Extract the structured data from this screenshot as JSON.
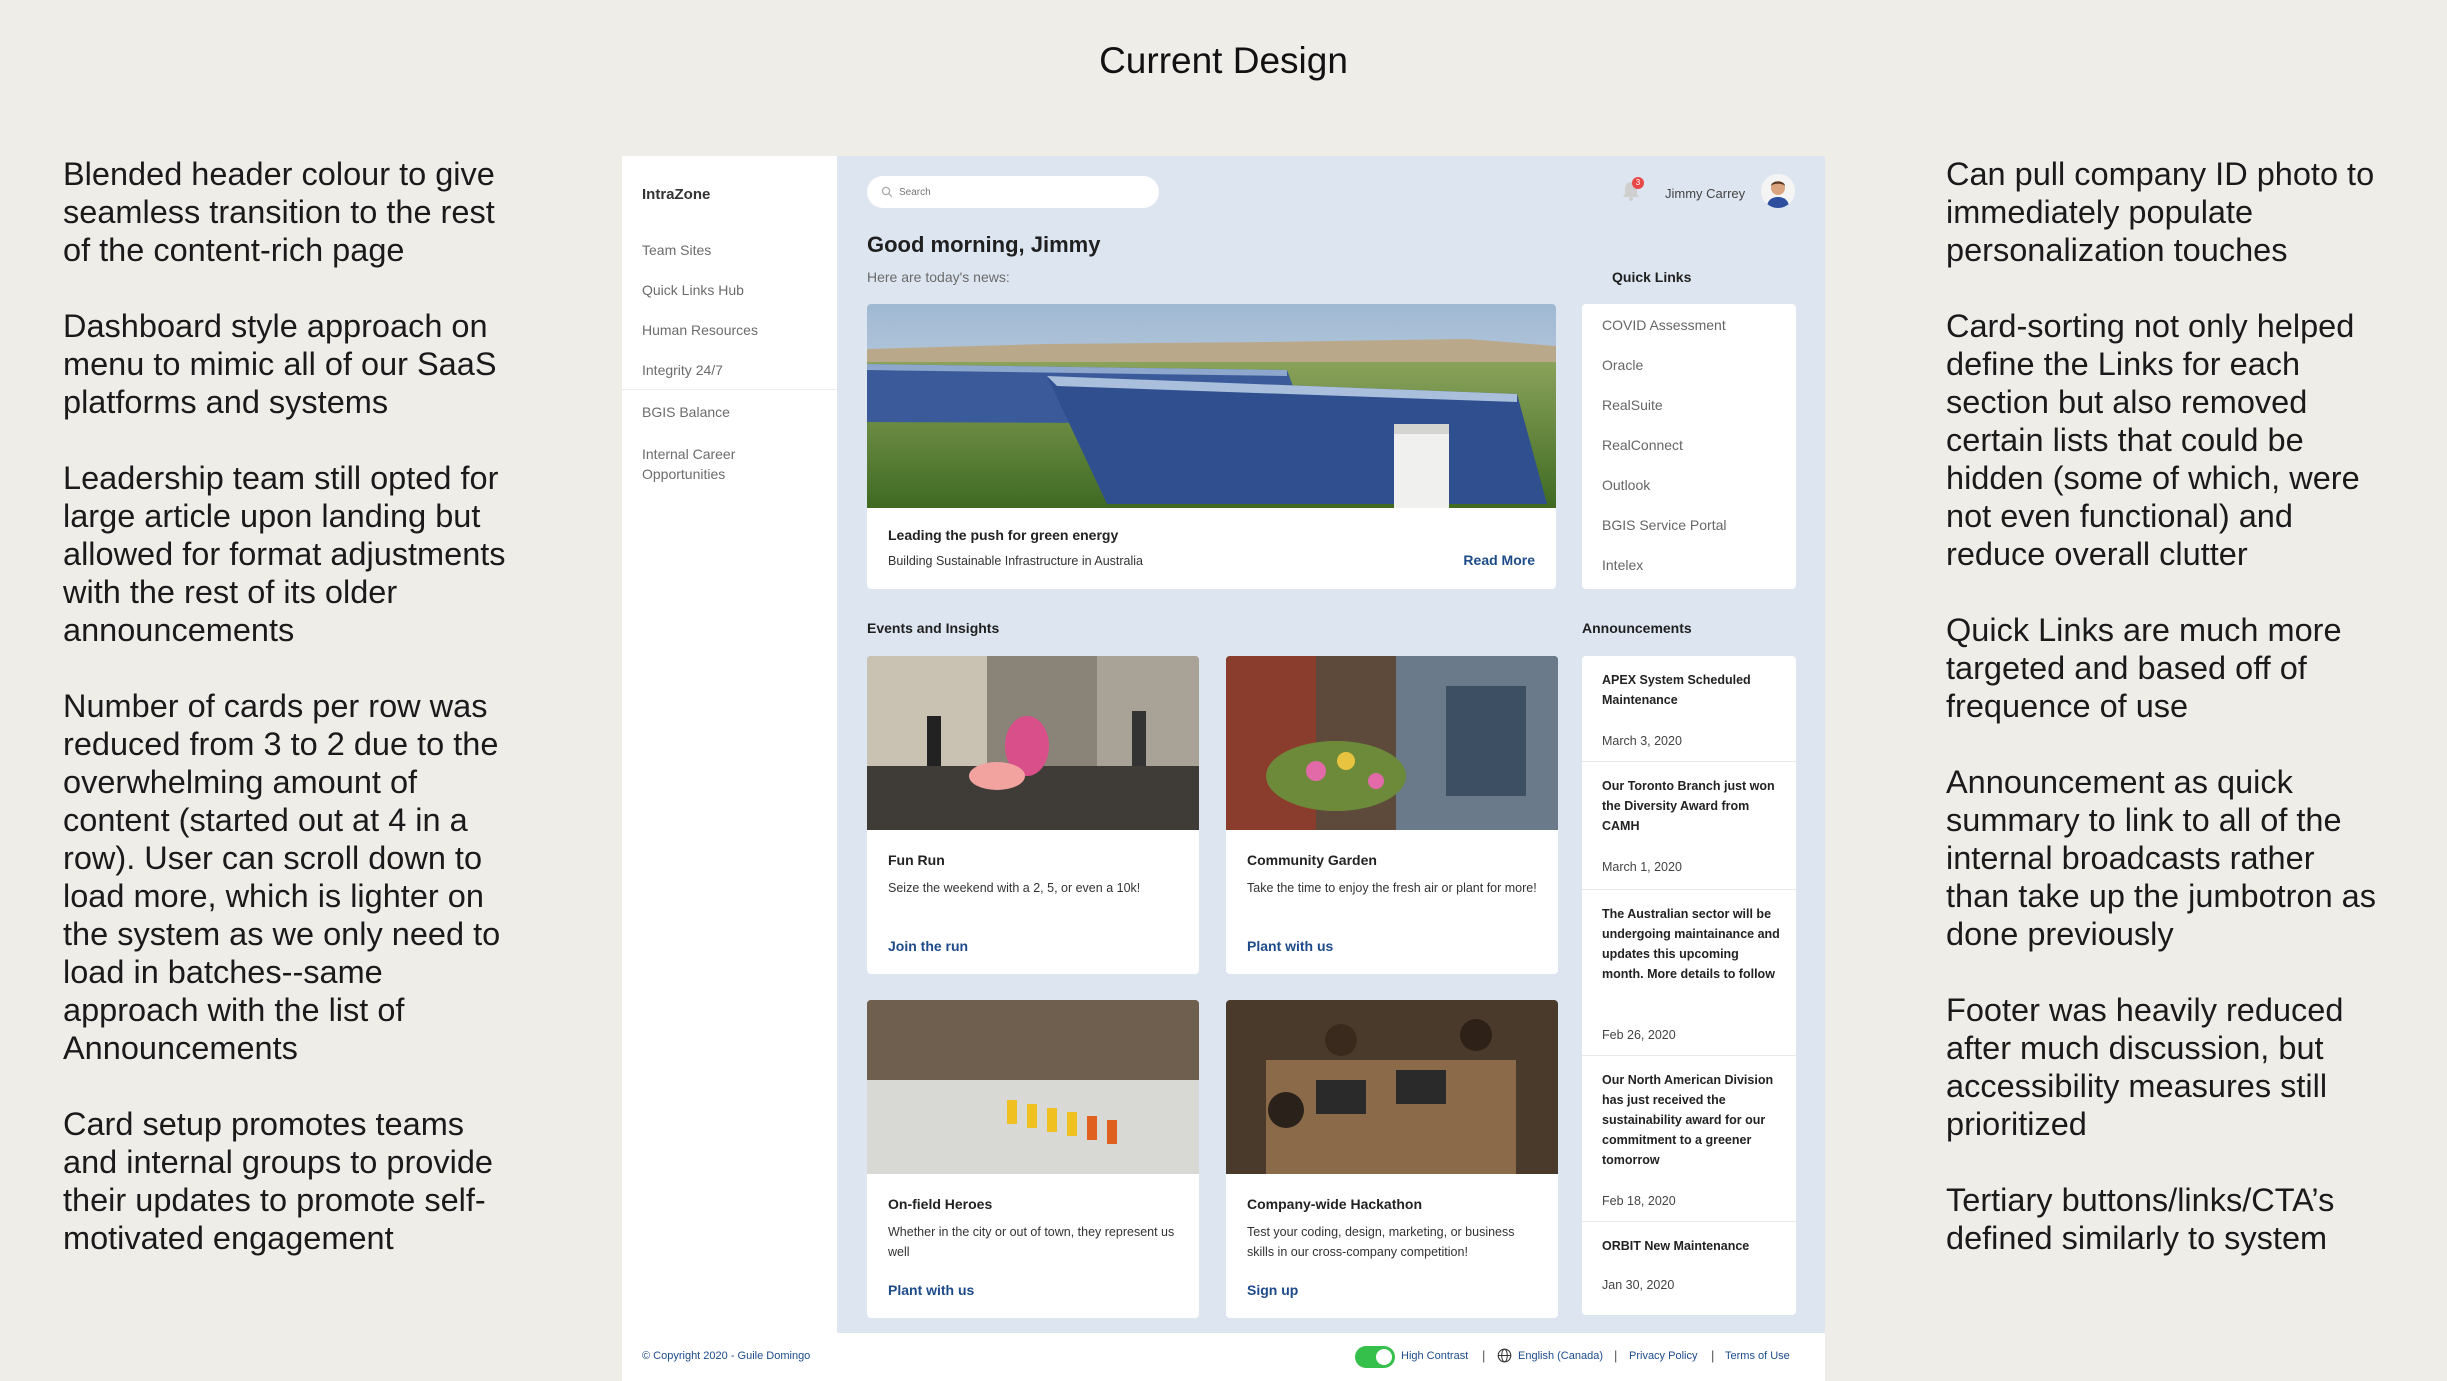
{
  "page_title": "Current Design",
  "notes_left": [
    "Blended header colour to give seamless transition to the rest of the content-rich page",
    "Dashboard style approach on menu to mimic all of our SaaS platforms and systems",
    "Leadership team still opted for large article upon landing but allowed for format adjustments with the rest of its older announcements",
    "Number of cards per row was reduced from 3 to 2 due to the overwhelming amount of content (started out at 4 in a row). User can scroll down to load more, which is lighter on the system as we only need to load in batches--same approach with the list of Announcements",
    "Card setup promotes teams and internal groups to provide their updates to promote self-motivated engagement"
  ],
  "notes_right": [
    "Can pull company ID photo to immediately populate personalization touches",
    "Card-sorting not only helped define the Links for each section but also removed certain lists that could be hidden (some of which, were not even functional) and reduce overall clutter",
    "Quick Links are much more targeted and based off of frequence of use",
    "Announcement as quick summary to link to all of the internal broadcasts rather than take up the jumbotron as done previously",
    "Footer was heavily reduced after much discussion, but accessibility measures still prioritized",
    "Tertiary buttons/links/CTA’s defined similarly to system"
  ],
  "sidebar": {
    "brand": "IntraZone",
    "items": [
      "Team Sites",
      "Quick Links Hub",
      "Human Resources",
      "Integrity 24/7",
      "BGIS Balance",
      "Internal Career Opportunities"
    ]
  },
  "header": {
    "search_placeholder": "Search",
    "notification_count": "3",
    "user_name": "Jimmy Carrey"
  },
  "greeting": {
    "title": "Good morning, Jimmy",
    "subtitle": "Here are today's news:"
  },
  "hero": {
    "title": "Leading the push for green energy",
    "subtitle": "Building Sustainable Infrastructure in Australia",
    "link": "Read More"
  },
  "quick_links": {
    "title": "Quick Links",
    "items": [
      "COVID Assessment",
      "Oracle",
      "RealSuite",
      "RealConnect",
      "Outlook",
      "BGIS Service Portal",
      "Intelex"
    ]
  },
  "events": {
    "title": "Events and Insights",
    "cards": [
      {
        "title": "Fun Run",
        "desc": "Seize the weekend with a 2, 5, or even a 10k!",
        "link": "Join the run"
      },
      {
        "title": "Community Garden",
        "desc": "Take the time to enjoy the fresh air or plant for more!",
        "link": "Plant with us"
      },
      {
        "title": "On-field Heroes",
        "desc": "Whether in the city or out of town, they represent us well",
        "link": "Plant with us"
      },
      {
        "title": "Company-wide Hackathon",
        "desc": "Test your coding, design, marketing, or business skills in our cross-company competition!",
        "link": "Sign up"
      }
    ]
  },
  "announcements": {
    "title": "Announcements",
    "items": [
      {
        "title": "APEX System Scheduled Maintenance",
        "date": "March 3, 2020"
      },
      {
        "title": "Our Toronto Branch just won the Diversity Award from CAMH",
        "date": "March 1, 2020"
      },
      {
        "title": "The Australian sector will be undergoing maintainance and updates this upcoming month. More details to follow",
        "date": "Feb 26, 2020"
      },
      {
        "title": "Our North American Division has just received the sustainability award for our commitment to a greener tomorrow",
        "date": "Feb 18, 2020"
      },
      {
        "title": "ORBIT New Maintenance",
        "date": "Jan 30, 2020"
      }
    ]
  },
  "footer": {
    "copyright": "© Copyright 2020 - Guile Domingo",
    "high_contrast": "High Contrast",
    "language": "English (Canada)",
    "privacy": "Privacy Policy",
    "terms": "Terms of Use",
    "separator": "|"
  },
  "colors": {
    "link": "#1d4b8a",
    "page_bg": "#efede8",
    "dashboard_bg": "#dde6f0",
    "toggle_on": "#34c04a"
  }
}
